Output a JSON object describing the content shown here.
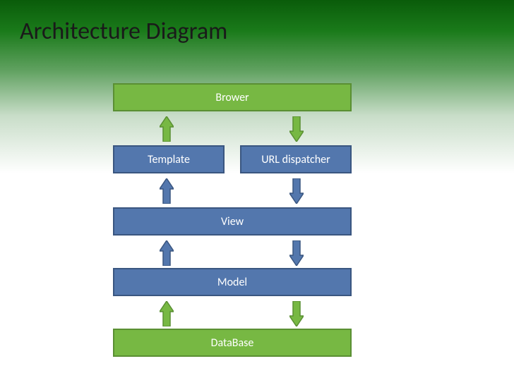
{
  "title": "Architecture Diagram",
  "boxes": {
    "browser": "Brower",
    "template": "Template",
    "url_dispatcher": "URL dispatcher",
    "view": "View",
    "model": "Model",
    "database": "DataBase"
  },
  "colors": {
    "green_fill": "#77b843",
    "green_border": "#5a8f33",
    "blue_fill": "#5377ad",
    "blue_border": "#3a5680"
  },
  "arrows": [
    {
      "from": "template",
      "to": "browser",
      "direction": "up",
      "color": "green"
    },
    {
      "from": "browser",
      "to": "url_dispatcher",
      "direction": "down",
      "color": "green"
    },
    {
      "from": "view",
      "to": "template",
      "direction": "up",
      "color": "blue"
    },
    {
      "from": "url_dispatcher",
      "to": "view",
      "direction": "down",
      "color": "blue"
    },
    {
      "from": "model",
      "to": "view",
      "direction": "up",
      "color": "blue"
    },
    {
      "from": "view",
      "to": "model",
      "direction": "down",
      "color": "blue"
    },
    {
      "from": "database",
      "to": "model",
      "direction": "up",
      "color": "green"
    },
    {
      "from": "model",
      "to": "database",
      "direction": "down",
      "color": "green"
    }
  ]
}
